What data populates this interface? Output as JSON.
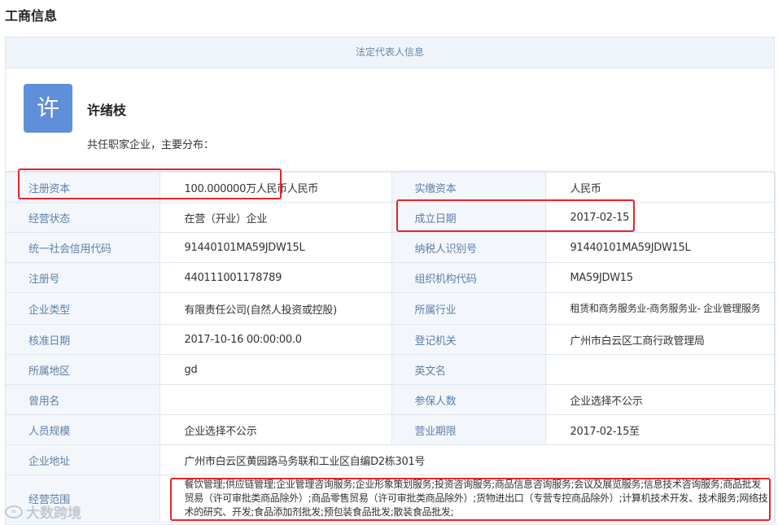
{
  "page_title": "工商信息",
  "section_header": "法定代表人信息",
  "legal_rep": {
    "avatar_char": "许",
    "name": "许绪枝",
    "subtitle": "共任职家企业，主要分布："
  },
  "rows": [
    {
      "l1": "注册资本",
      "v1": "100.000000万人民币人民币",
      "l2": "实缴资本",
      "v2": "人民币"
    },
    {
      "l1": "经营状态",
      "v1": "在营（开业）企业",
      "l2": "成立日期",
      "v2": "2017-02-15"
    },
    {
      "l1": "统一社会信用代码",
      "v1": "91440101MA59JDW15L",
      "l2": "纳税人识别号",
      "v2": "91440101MA59JDW15L"
    },
    {
      "l1": "注册号",
      "v1": "440111001178789",
      "l2": "组织机构代码",
      "v2": "MA59JDW15"
    },
    {
      "l1": "企业类型",
      "v1": "有限责任公司(自然人投资或控股)",
      "l2": "所属行业",
      "v2": "租赁和商务服务业-商务服务业- 企业管理服务"
    },
    {
      "l1": "核准日期",
      "v1": "2017-10-16 00:00:00.0",
      "l2": "登记机关",
      "v2": "广州市白云区工商行政管理局"
    },
    {
      "l1": "所属地区",
      "v1": "gd",
      "l2": "英文名",
      "v2": ""
    },
    {
      "l1": "曾用名",
      "v1": "",
      "l2": "参保人数",
      "v2": "企业选择不公示"
    },
    {
      "l1": "人员规模",
      "v1": "企业选择不公示",
      "l2": "营业期限",
      "v2": "2017-02-15至"
    }
  ],
  "address": {
    "label": "企业地址",
    "value": "广州市白云区黄园路马务联和工业区自编D2栋301号"
  },
  "scope": {
    "label": "经营范围",
    "value": "餐饮管理;供应链管理;企业管理咨询服务;企业形象策划服务;投资咨询服务;商品信息咨询服务;会议及展览服务;信息技术咨询服务;商品批发贸易（许可审批类商品除外）;商品零售贸易（许可审批类商品除外）;货物进出口（专营专控商品除外）;计算机技术开发、技术服务;网络技术的研究、开发;食品添加剂批发;预包装食品批发;散装食品批发;"
  },
  "watermark": "大数跨境",
  "colors": {
    "highlight": "#e8232a",
    "avatar_bg": "#5e8fd8",
    "label_text": "#5f7fa8",
    "label_bg": "#f3f7fc"
  }
}
